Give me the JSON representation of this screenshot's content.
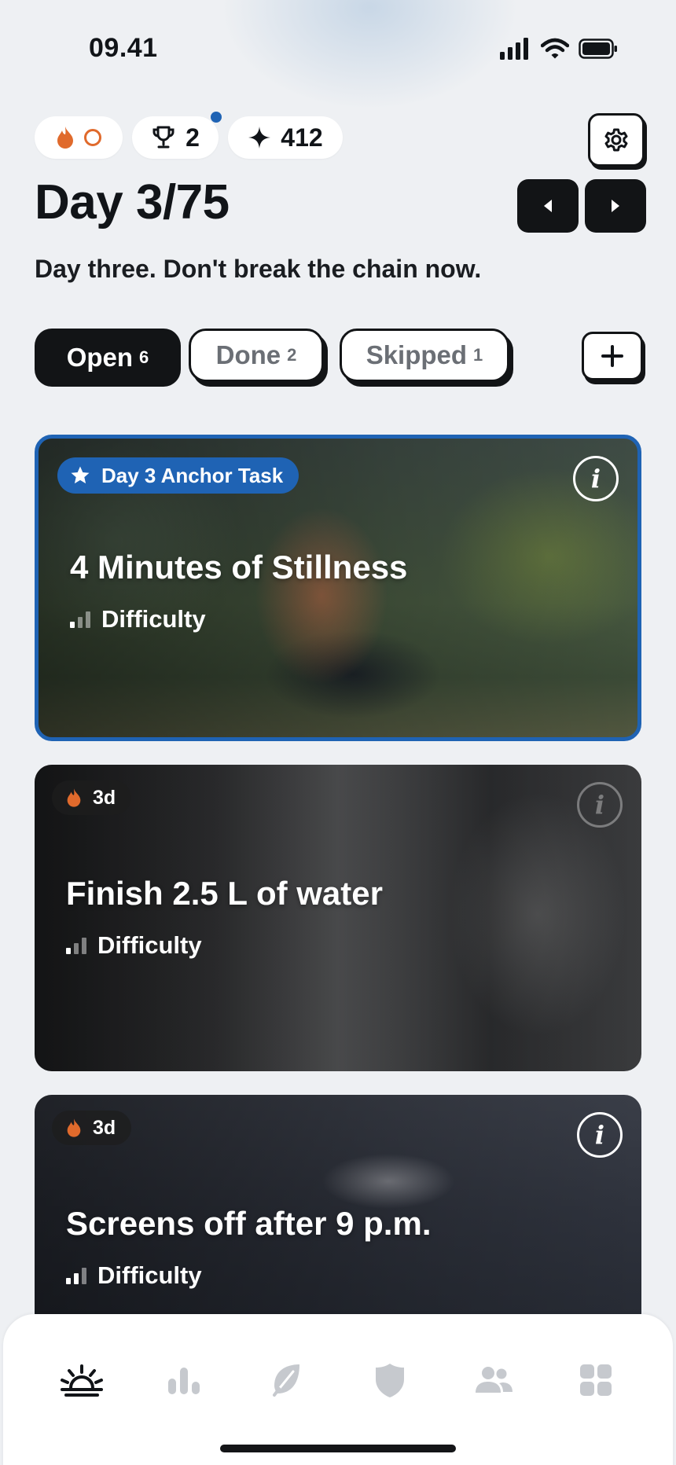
{
  "status_bar": {
    "time": "09.41"
  },
  "chips": {
    "streak_value": "0",
    "trophies": "2",
    "points": "412"
  },
  "header": {
    "title": "Day 3/75",
    "subtitle": "Day three. Don't break the chain now."
  },
  "tabs": [
    {
      "label": "Open",
      "count": "6",
      "active": true
    },
    {
      "label": "Done",
      "count": "2",
      "active": false
    },
    {
      "label": "Skipped",
      "count": "1",
      "active": false
    }
  ],
  "cards": [
    {
      "badge": "Day 3 Anchor Task",
      "title": "4 Minutes of Stillness",
      "difficulty_label": "Difficulty",
      "difficulty_level": "1 of 3"
    },
    {
      "badge": "3d",
      "title": "Finish 2.5 L of water",
      "difficulty_label": "Difficulty",
      "difficulty_level": "1 of 3"
    },
    {
      "badge": "3d",
      "title": "Screens off after 9 p.m.",
      "difficulty_label": "Difficulty",
      "difficulty_level": "2 of 3"
    }
  ],
  "nav": [
    {
      "icon": "sunrise-icon",
      "active": true
    },
    {
      "icon": "bar-chart-icon",
      "active": false
    },
    {
      "icon": "leaf-icon",
      "active": false
    },
    {
      "icon": "shield-icon",
      "active": false
    },
    {
      "icon": "people-icon",
      "active": false
    },
    {
      "icon": "grid-icon",
      "active": false
    }
  ],
  "colors": {
    "accent_blue": "#1f63b4",
    "flame_orange": "#e06a2c",
    "dark": "#121416",
    "background": "#eef0f3"
  }
}
